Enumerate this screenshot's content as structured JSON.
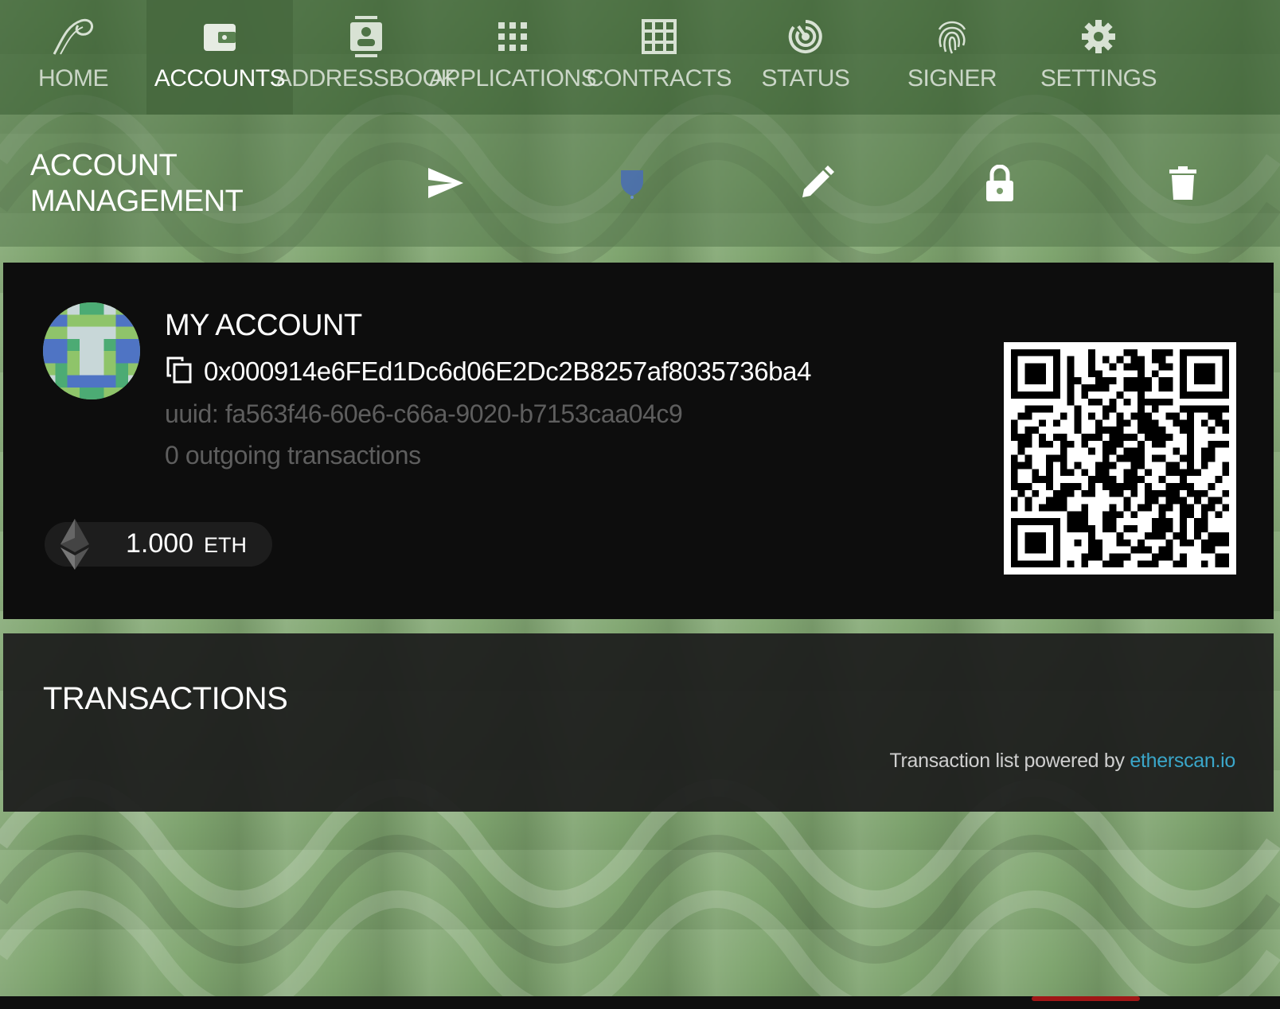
{
  "nav": {
    "items": [
      {
        "label": "HOME",
        "icon": "parity-logo-icon",
        "active": false
      },
      {
        "label": "ACCOUNTS",
        "icon": "wallet-icon",
        "active": true
      },
      {
        "label": "ADDRESSBOOK",
        "icon": "contact-card-icon",
        "active": false
      },
      {
        "label": "APPLICATIONS",
        "icon": "apps-grid-icon",
        "active": false
      },
      {
        "label": "CONTRACTS",
        "icon": "table-grid-icon",
        "active": false
      },
      {
        "label": "STATUS",
        "icon": "status-dial-icon",
        "active": false
      },
      {
        "label": "SIGNER",
        "icon": "fingerprint-icon",
        "active": false
      },
      {
        "label": "SETTINGS",
        "icon": "gear-icon",
        "active": false
      }
    ]
  },
  "management": {
    "title": "ACCOUNT MANAGEMENT",
    "actions": [
      "send-icon",
      "shield-icon",
      "pencil-icon",
      "lock-icon",
      "trash-icon"
    ]
  },
  "account": {
    "name": "MY ACCOUNT",
    "address": "0x000914e6FEd1Dc6d06E2Dc2B8257af8035736ba4",
    "uuid": "uuid: fa563f46-60e6-c66a-9020-b7153caa04c9",
    "transactions": "0 outgoing transactions",
    "balance": {
      "value": "1.000",
      "unit": "ETH"
    }
  },
  "transactions": {
    "title": "TRANSACTIONS",
    "powered_by": "Transaction list powered by ",
    "link_text": "etherscan.io"
  },
  "colors": {
    "background": "#7fa56f",
    "nav": "#3c5f34",
    "card": "#0d0d0d",
    "link": "#3aa6c9"
  }
}
